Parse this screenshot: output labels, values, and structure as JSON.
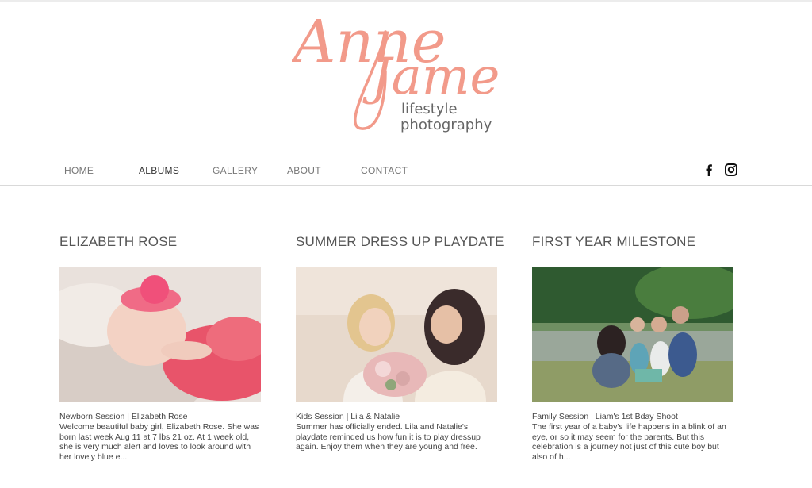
{
  "brand": {
    "name_part1": "Anne",
    "name_part2": "James",
    "tagline1": "lifestyle",
    "tagline2": "photography",
    "accent": "#f29a8a"
  },
  "nav": {
    "items": [
      {
        "label": "HOME"
      },
      {
        "label": "ALBUMS"
      },
      {
        "label": "GALLERY"
      },
      {
        "label": "ABOUT"
      },
      {
        "label": "CONTACT"
      }
    ]
  },
  "social": {
    "icons": [
      "facebook-icon",
      "instagram-icon"
    ]
  },
  "albums": [
    {
      "title": "ELIZABETH ROSE",
      "subtitle": "Newborn Session | Elizabeth Rose",
      "description": "Welcome beautiful baby girl, Elizabeth Rose. She was born last week Aug 11 at 7 lbs 21 oz. At 1 week old, she is very much alert and loves to look around with her lovely blue e..."
    },
    {
      "title": "SUMMER DRESS UP PLAYDATE",
      "subtitle": "Kids Session | Lila & Natalie",
      "description": "Summer has officially ended. Lila and Natalie's playdate reminded us how fun it is to play dressup again. Enjoy them when they are young and free."
    },
    {
      "title": "FIRST YEAR MILESTONE",
      "subtitle": "Family Session | Liam's 1st Bday Shoot",
      "description": "The first year of a baby's life happens in a blink of an eye, or so it may seem for the parents. But this celebration is a journey not just of this cute boy but also of h..."
    }
  ]
}
